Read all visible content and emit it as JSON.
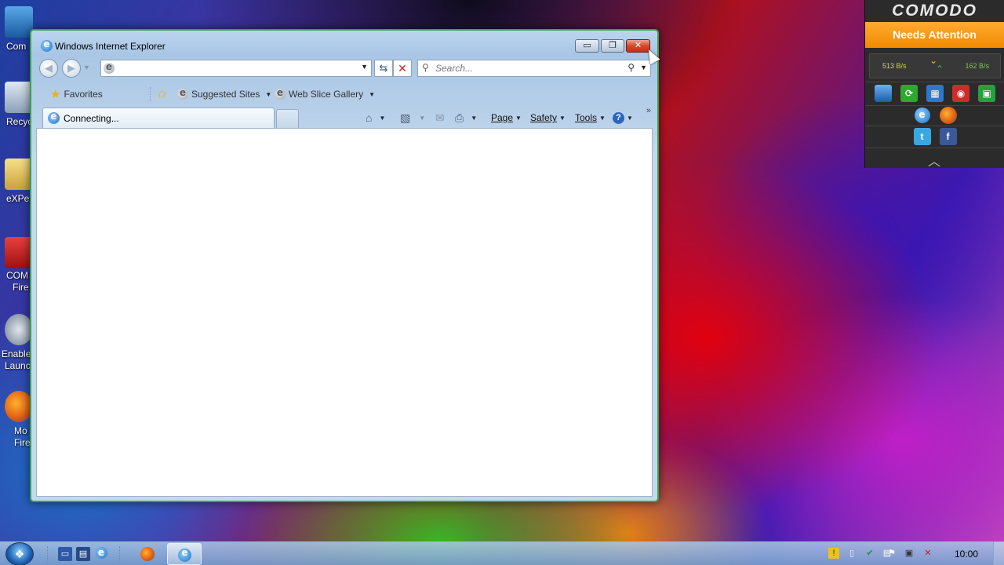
{
  "desktop": {
    "icons": [
      {
        "label": "Com",
        "label2": ""
      },
      {
        "label": "Recyc",
        "label2": ""
      },
      {
        "label": "eXPer",
        "label2": ""
      },
      {
        "label": "COM",
        "label2": "Fire"
      },
      {
        "label": "Enable",
        "label2": "Launc"
      },
      {
        "label": "Mo",
        "label2": "Fire"
      }
    ]
  },
  "window": {
    "title": "Windows Internet Explorer",
    "buttons": {
      "minimize": "▭",
      "maximize": "❐",
      "close": "✕"
    }
  },
  "address_bar": {
    "value": "",
    "placeholder": ""
  },
  "search": {
    "placeholder": "Search..."
  },
  "favorites_bar": {
    "favorites_label": "Favorites",
    "suggested_sites_label": "Suggested Sites",
    "web_slice_gallery_label": "Web Slice Gallery"
  },
  "tab": {
    "active_label": "Connecting..."
  },
  "command_bar": {
    "page_label": "Page",
    "safety_label": "Safety",
    "tools_label": "Tools",
    "overflow": "»"
  },
  "comodo": {
    "logo": "COMODO",
    "status": "Needs Attention",
    "traffic_in": "513 B/s",
    "traffic_out": "162 B/s",
    "status_color": "#f59a10"
  },
  "taskbar": {
    "clock": "10:00"
  },
  "colors": {
    "window_border": "#2fa84a",
    "close_button": "#d44a2a"
  }
}
